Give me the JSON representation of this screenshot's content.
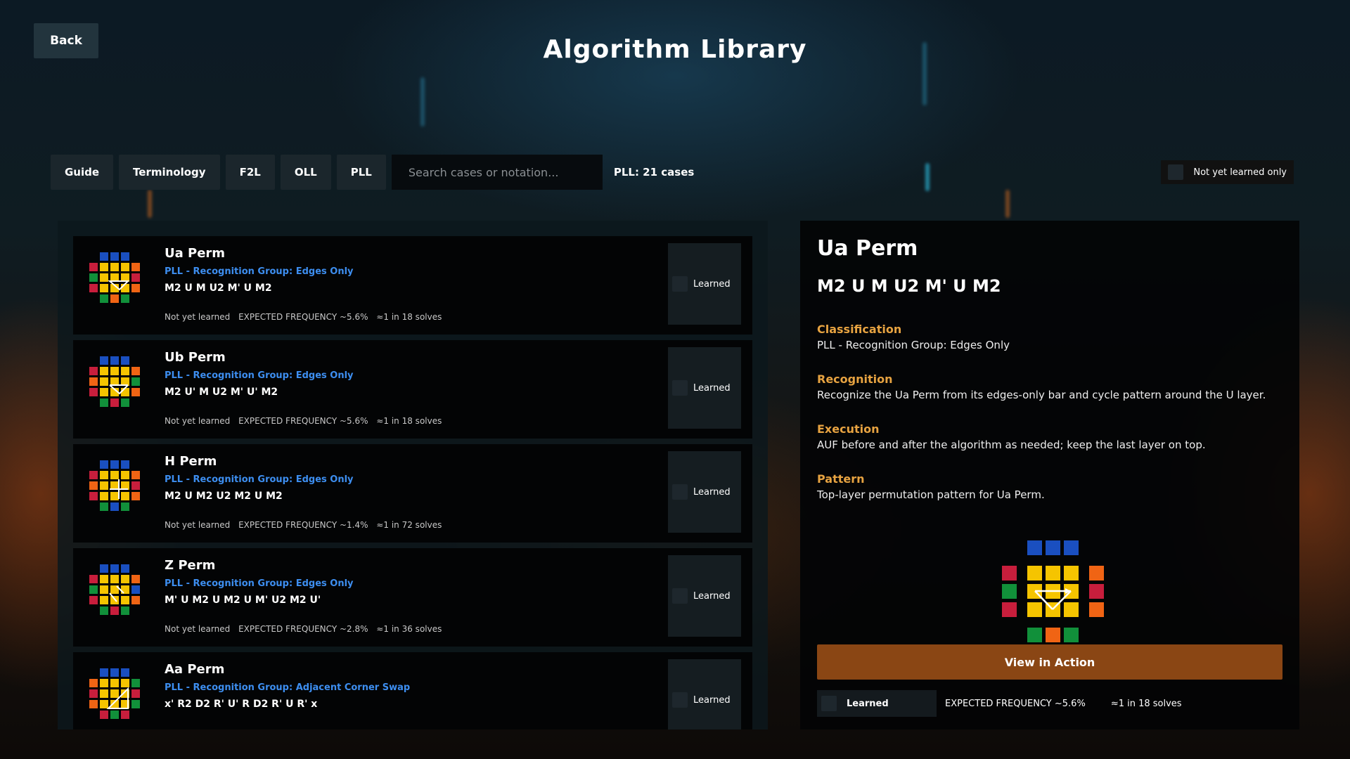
{
  "header": {
    "back_label": "Back",
    "title": "Algorithm Library"
  },
  "toolbar": {
    "tabs": [
      "Guide",
      "Terminology",
      "F2L",
      "OLL",
      "PLL"
    ],
    "search_placeholder": "Search cases or notation...",
    "case_count": "PLL: 21 cases",
    "filter_label": "Not yet learned only"
  },
  "cases": [
    {
      "name": "Ua Perm",
      "group": "PLL  -  Recognition Group: Edges Only",
      "alg": "M2 U M U2 M' U M2",
      "status": "Not yet learned",
      "freq": "EXPECTED FREQUENCY ~5.6%",
      "solves": "≈1 in 18 solves",
      "learned_label": "Learned"
    },
    {
      "name": "Ub Perm",
      "group": "PLL  -  Recognition Group: Edges Only",
      "alg": "M2 U' M U2 M' U' M2",
      "status": "Not yet learned",
      "freq": "EXPECTED FREQUENCY ~5.6%",
      "solves": "≈1 in 18 solves",
      "learned_label": "Learned"
    },
    {
      "name": "H Perm",
      "group": "PLL  -  Recognition Group: Edges Only",
      "alg": "M2 U M2 U2 M2 U M2",
      "status": "Not yet learned",
      "freq": "EXPECTED FREQUENCY ~1.4%",
      "solves": "≈1 in 72 solves",
      "learned_label": "Learned"
    },
    {
      "name": "Z Perm",
      "group": "PLL  -  Recognition Group: Edges Only",
      "alg": "M' U M2 U M2 U M' U2 M2 U'",
      "status": "Not yet learned",
      "freq": "EXPECTED FREQUENCY ~2.8%",
      "solves": "≈1 in 36 solves",
      "learned_label": "Learned"
    },
    {
      "name": "Aa Perm",
      "group": "PLL  -  Recognition Group: Adjacent Corner Swap",
      "alg": "x' R2 D2 R' U' R D2 R' U R' x",
      "status": "",
      "freq": "",
      "solves": "",
      "learned_label": "Learned"
    }
  ],
  "detail": {
    "name": "Ua Perm",
    "alg": "M2 U M U2 M' U M2",
    "sections": [
      {
        "heading": "Classification",
        "text": "PLL  -  Recognition Group: Edges Only"
      },
      {
        "heading": "Recognition",
        "text": "Recognize the Ua Perm from its edges-only bar and cycle pattern around the U layer."
      },
      {
        "heading": "Execution",
        "text": "AUF before and after the algorithm as needed; keep the last layer on top."
      },
      {
        "heading": "Pattern",
        "text": "Top-layer permutation pattern for Ua Perm."
      }
    ],
    "action_label": "View in Action",
    "learned_label": "Learned",
    "freq": "EXPECTED FREQUENCY  ~5.6%",
    "solves": "≈1 in 18 solves"
  },
  "colors": {
    "yellow": "#f5c400",
    "blue": "#1a4fc0",
    "red": "#c81e3c",
    "green": "#11903a",
    "orange": "#f06414",
    "accent": "#e7a341",
    "link": "#3d8ef0"
  }
}
